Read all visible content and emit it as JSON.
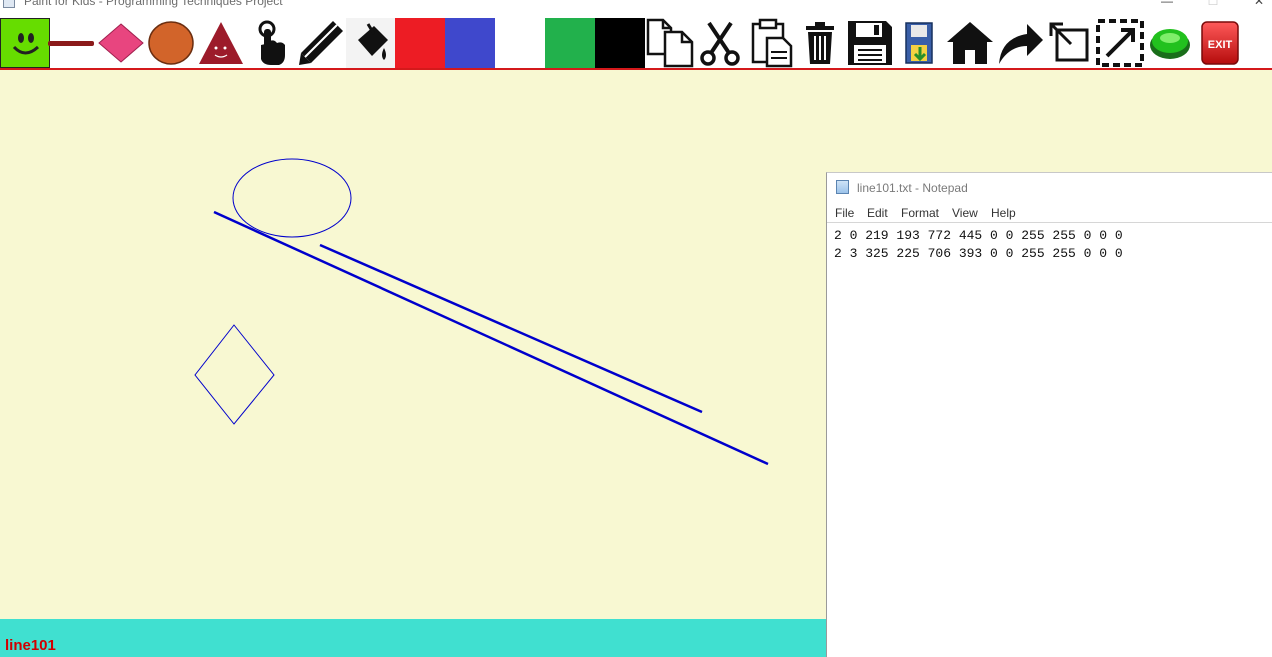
{
  "window": {
    "title": "Paint for Kids - Programming Techniques Project",
    "minimize_glyph": "—",
    "maximize_glyph": "☐",
    "close_glyph": "✕"
  },
  "toolbar": {
    "items": [
      {
        "name": "smiley-mode-icon"
      },
      {
        "name": "line-tool-icon"
      },
      {
        "name": "rhombus-tool-icon"
      },
      {
        "name": "circle-tool-icon"
      },
      {
        "name": "triangle-tool-icon"
      },
      {
        "name": "select-tool-icon"
      },
      {
        "name": "pencil-tool-icon"
      },
      {
        "name": "fill-bucket-icon"
      },
      {
        "name": "color-red-swatch",
        "color": "#ed1c24"
      },
      {
        "name": "color-blue-swatch",
        "color": "#3f48cc"
      },
      {
        "name": "color-white-swatch",
        "color": "#ffffff"
      },
      {
        "name": "color-green-swatch",
        "color": "#22b14c"
      },
      {
        "name": "color-black-swatch",
        "color": "#000000"
      },
      {
        "name": "copy-icon"
      },
      {
        "name": "cut-icon"
      },
      {
        "name": "paste-icon"
      },
      {
        "name": "delete-icon"
      },
      {
        "name": "save-icon"
      },
      {
        "name": "save-by-type-icon"
      },
      {
        "name": "load-icon"
      },
      {
        "name": "redo-icon"
      },
      {
        "name": "resize-icon"
      },
      {
        "name": "scramble-icon"
      },
      {
        "name": "play-mode-icon"
      },
      {
        "name": "exit-icon"
      }
    ],
    "exit_label": "EXIT"
  },
  "colors": {
    "toolbar_underline": "#d4191b",
    "canvas_bg": "#f8f8d2",
    "status_bg": "#40e0d0",
    "status_text": "#d00000",
    "shape_stroke": "#0000cc"
  },
  "statusbar": {
    "message": "line101"
  },
  "notepad": {
    "title": "line101.txt - Notepad",
    "menu": [
      "File",
      "Edit",
      "Format",
      "View",
      "Help"
    ],
    "lines": [
      "2 0 219 193 772 445 0 0 255 255 0 0 0",
      "2 3 325 225 706 393 0 0 255 255 0 0 0"
    ]
  }
}
